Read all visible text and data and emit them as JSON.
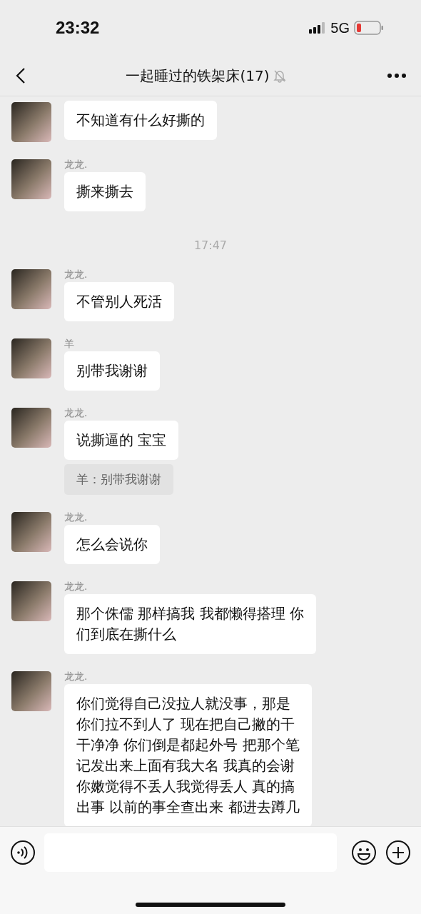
{
  "status_bar": {
    "time": "23:32",
    "network": "5G"
  },
  "header": {
    "title": "一起睡过的铁架床(17)",
    "muted": true
  },
  "messages": [
    {
      "kind": "message",
      "lines": [
        "不知道有什么好撕的"
      ]
    },
    {
      "kind": "message",
      "sender": "龙龙.",
      "lines": [
        "撕来撕去"
      ]
    },
    {
      "kind": "time",
      "text": "17:47"
    },
    {
      "kind": "message",
      "sender": "龙龙.",
      "lines": [
        "不管别人死活"
      ]
    },
    {
      "kind": "message",
      "sender": "羊",
      "lines": [
        "别带我谢谢"
      ]
    },
    {
      "kind": "message",
      "sender": "龙龙.",
      "lines": [
        "说撕逼的 宝宝"
      ],
      "quote": "羊：别带我谢谢"
    },
    {
      "kind": "message",
      "sender": "龙龙.",
      "lines": [
        "怎么会说你"
      ]
    },
    {
      "kind": "message",
      "sender": "龙龙.",
      "lines": [
        "那个侏儒 那样搞我 我都懒得搭理 你",
        "们到底在撕什么"
      ]
    },
    {
      "kind": "message",
      "sender": "龙龙.",
      "lines": [
        "你们觉得自己没拉人就没事，那是",
        "你们拉不到人了 现在把自己撇的干",
        "干净净 你们倒是都起外号 把那个笔",
        "记发出来上面有我大名 我真的会谢",
        "你嫩觉得不丢人我觉得丢人 真的搞",
        "出事 以前的事全查出来 都进去蹲几"
      ]
    }
  ]
}
